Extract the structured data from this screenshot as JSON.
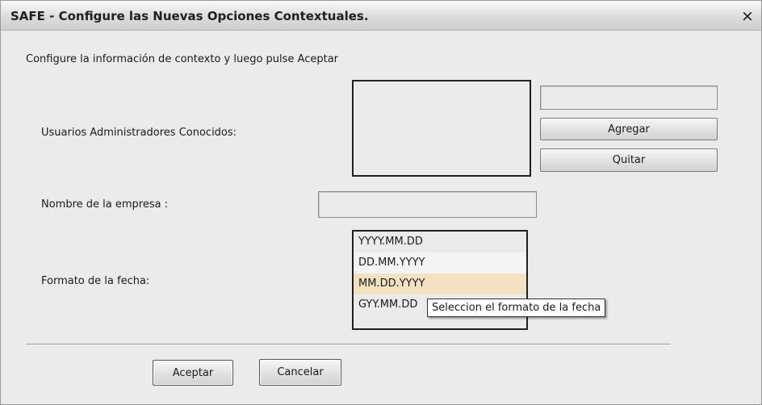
{
  "window": {
    "title": "SAFE - Configure las Nuevas Opciones Contextuales.",
    "close_glyph": "×"
  },
  "instruction": "Configure la información de contexto y luego pulse Aceptar",
  "admins": {
    "label": "Usuarios Administradores Conocidos:",
    "input_value": "",
    "add_label": "Agregar",
    "remove_label": "Quitar"
  },
  "company": {
    "label": "Nombre de la empresa :",
    "value": ""
  },
  "date_format": {
    "label": "Formato de la fecha:",
    "options": [
      "YYYY.MM.DD",
      "DD.MM.YYYY",
      "MM.DD.YYYY",
      "GYY.MM.DD"
    ],
    "hovered": "MM.DD.YYYY",
    "tooltip": "Seleccion el formato de la fecha"
  },
  "footer": {
    "accept_label": "Aceptar",
    "cancel_label": "Cancelar"
  }
}
